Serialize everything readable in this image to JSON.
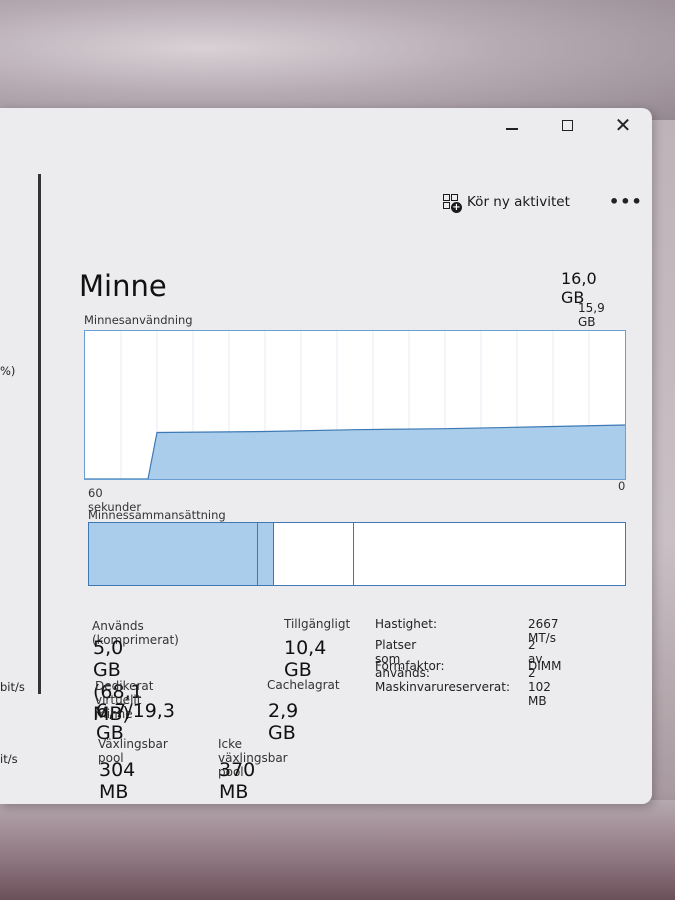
{
  "header": {
    "run_task_label": "Kör ny aktivitet"
  },
  "sidebar_fragments": {
    "frag1": "%)",
    "frag2": "bit/s",
    "frag3": "it/s"
  },
  "memory": {
    "title": "Minne",
    "total": "16,0 GB",
    "usage_label": "Minnesanvändning",
    "usage_max": "15,9 GB",
    "axis_left": "60 sekunder",
    "axis_right": "0",
    "composition_label": "Minnessammansättning"
  },
  "chart_data": {
    "type": "area",
    "title": "Minnesanvändning",
    "xlabel": "60 sekunder",
    "ylabel": "",
    "xlim": [
      60,
      0
    ],
    "ylim": [
      0,
      15.9
    ],
    "x": [
      60,
      53,
      52,
      40,
      30,
      20,
      10,
      0
    ],
    "values": [
      0,
      0,
      5.0,
      5.1,
      5.3,
      5.4,
      5.6,
      5.8
    ],
    "grid": true,
    "color": "#a9cdea",
    "line_color": "#3f79b5"
  },
  "composition": {
    "segments": [
      {
        "name": "in_use",
        "fraction": 0.315,
        "fill": "#a9cdea"
      },
      {
        "name": "modified",
        "fraction": 0.03,
        "fill": "#a9cdea"
      },
      {
        "name": "standby",
        "fraction": 0.15,
        "fill": "#ffffff"
      },
      {
        "name": "free",
        "fraction": 0.505,
        "fill": "#ffffff"
      }
    ]
  },
  "stats": {
    "in_use_label": "Används (komprimerat)",
    "in_use_value": "5,0 GB (68,1 MB)",
    "available_label": "Tillgängligt",
    "available_value": "10,4 GB",
    "committed_label": "Dedikerat virtuellt minne",
    "committed_value": "6,7/19,3 GB",
    "cached_label": "Cachelagrat",
    "cached_value": "2,9 GB",
    "paged_label": "Växlingsbar pool",
    "paged_value": "304 MB",
    "nonpaged_label": "Icke växlingsbar pool",
    "nonpaged_value": "370 MB"
  },
  "properties": {
    "speed_label": "Hastighet:",
    "speed_value": "2667 MT/s",
    "slots_label": "Platser som används:",
    "slots_value": "2 av 2",
    "form_label": "Formfaktor:",
    "form_value": "DIMM",
    "reserved_label": "Maskinvarureserverat:",
    "reserved_value": "102 MB"
  }
}
